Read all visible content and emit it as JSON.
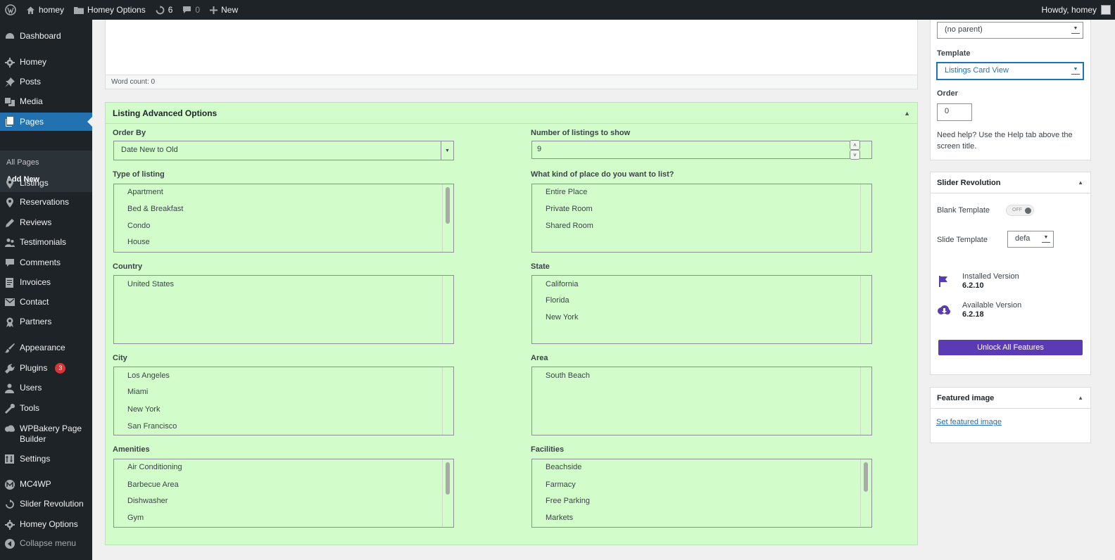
{
  "adminbar": {
    "site_name": "homey",
    "options_label": "Homey Options",
    "updates_count": "6",
    "comments_count": "0",
    "new_label": "New",
    "greeting": "Howdy, homey"
  },
  "sidebar": {
    "items": [
      {
        "label": "Dashboard",
        "icon": "dashboard-icon"
      },
      {
        "label": "Homey",
        "icon": "gear-icon"
      },
      {
        "label": "Posts",
        "icon": "pin-icon"
      },
      {
        "label": "Media",
        "icon": "media-icon"
      },
      {
        "label": "Pages",
        "icon": "pages-icon"
      },
      {
        "label": "Listings",
        "icon": "location-icon"
      },
      {
        "label": "Reservations",
        "icon": "location-icon"
      },
      {
        "label": "Reviews",
        "icon": "edit-icon"
      },
      {
        "label": "Testimonials",
        "icon": "people-icon"
      },
      {
        "label": "Comments",
        "icon": "comment-icon"
      },
      {
        "label": "Invoices",
        "icon": "document-icon"
      },
      {
        "label": "Contact",
        "icon": "envelope-icon"
      },
      {
        "label": "Partners",
        "icon": "award-icon"
      },
      {
        "label": "Appearance",
        "icon": "brush-icon"
      },
      {
        "label": "Plugins",
        "icon": "plugin-icon",
        "badge": "3"
      },
      {
        "label": "Users",
        "icon": "user-icon"
      },
      {
        "label": "Tools",
        "icon": "wrench-icon"
      },
      {
        "label": "WPBakery Page Builder",
        "icon": "cloud-icon"
      },
      {
        "label": "Settings",
        "icon": "settings-icon"
      },
      {
        "label": "MC4WP",
        "icon": "mc4wp-icon"
      },
      {
        "label": "Slider Revolution",
        "icon": "refresh-icon"
      },
      {
        "label": "Homey Options",
        "icon": "gear-icon"
      },
      {
        "label": "Collapse menu",
        "icon": "collapse-icon"
      }
    ],
    "submenu": [
      "All Pages",
      "Add New"
    ]
  },
  "editor": {
    "word_count": "Word count: 0"
  },
  "listing_options": {
    "title": "Listing Advanced Options",
    "order_by_label": "Order By",
    "order_by_value": "Date New to Old",
    "num_label": "Number of listings to show",
    "num_value": "9",
    "type_label": "Type of listing",
    "type_options": [
      "Apartment",
      "Bed & Breakfast",
      "Condo",
      "House"
    ],
    "kind_label": "What kind of place do you want to list?",
    "kind_options": [
      "Entire Place",
      "Private Room",
      "Shared Room"
    ],
    "country_label": "Country",
    "country_options": [
      "United States"
    ],
    "state_label": "State",
    "state_options": [
      "California",
      "Florida",
      "New York"
    ],
    "city_label": "City",
    "city_options": [
      "Los Angeles",
      "Miami",
      "New York",
      "San Francisco"
    ],
    "area_label": "Area",
    "area_options": [
      "South Beach"
    ],
    "amenities_label": "Amenities",
    "amenities_options": [
      "Air Conditioning",
      "Barbecue Area",
      "Dishwasher",
      "Gym"
    ],
    "facilities_label": "Facilities",
    "facilities_options": [
      "Beachside",
      "Farmacy",
      "Free Parking",
      "Markets"
    ]
  },
  "page_attributes": {
    "parent_value": "(no parent)",
    "template_label": "Template",
    "template_value": "Listings Card View",
    "order_label": "Order",
    "order_value": "0",
    "help_text": "Need help? Use the Help tab above the screen title."
  },
  "slider_revolution": {
    "title": "Slider Revolution",
    "blank_template_label": "Blank Template",
    "blank_template_state": "OFF",
    "slide_template_label": "Slide Template",
    "slide_template_value": "defa",
    "installed_label": "Installed Version",
    "installed_version": "6.2.10",
    "available_label": "Available Version",
    "available_version": "6.2.18",
    "unlock_label": "Unlock All Features",
    "accent_color": "#5b3bb4"
  },
  "featured_image": {
    "title": "Featured image",
    "link_label": "Set featured image"
  }
}
